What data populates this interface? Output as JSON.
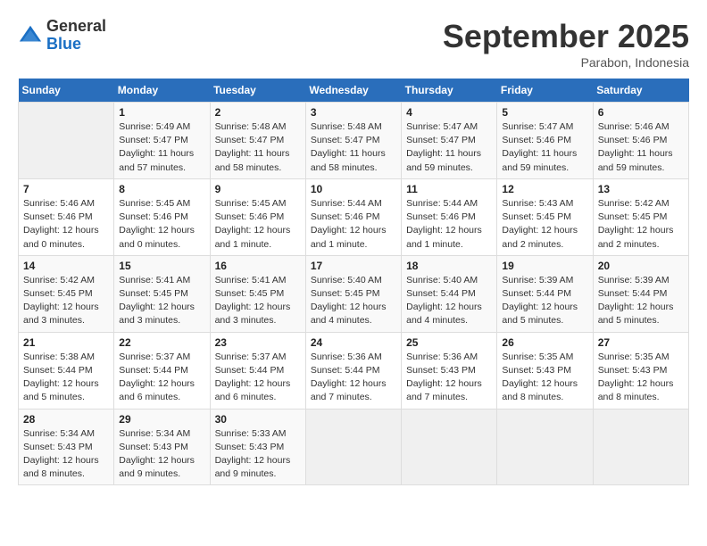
{
  "logo": {
    "general": "General",
    "blue": "Blue"
  },
  "title": "September 2025",
  "subtitle": "Parabon, Indonesia",
  "days_of_week": [
    "Sunday",
    "Monday",
    "Tuesday",
    "Wednesday",
    "Thursday",
    "Friday",
    "Saturday"
  ],
  "weeks": [
    [
      {
        "day": "",
        "empty": true
      },
      {
        "day": "1",
        "sunrise": "5:49 AM",
        "sunset": "5:47 PM",
        "daylight": "11 hours and 57 minutes."
      },
      {
        "day": "2",
        "sunrise": "5:48 AM",
        "sunset": "5:47 PM",
        "daylight": "11 hours and 58 minutes."
      },
      {
        "day": "3",
        "sunrise": "5:48 AM",
        "sunset": "5:47 PM",
        "daylight": "11 hours and 58 minutes."
      },
      {
        "day": "4",
        "sunrise": "5:47 AM",
        "sunset": "5:47 PM",
        "daylight": "11 hours and 59 minutes."
      },
      {
        "day": "5",
        "sunrise": "5:47 AM",
        "sunset": "5:46 PM",
        "daylight": "11 hours and 59 minutes."
      },
      {
        "day": "6",
        "sunrise": "5:46 AM",
        "sunset": "5:46 PM",
        "daylight": "11 hours and 59 minutes."
      }
    ],
    [
      {
        "day": "7",
        "sunrise": "5:46 AM",
        "sunset": "5:46 PM",
        "daylight": "12 hours and 0 minutes."
      },
      {
        "day": "8",
        "sunrise": "5:45 AM",
        "sunset": "5:46 PM",
        "daylight": "12 hours and 0 minutes."
      },
      {
        "day": "9",
        "sunrise": "5:45 AM",
        "sunset": "5:46 PM",
        "daylight": "12 hours and 1 minute."
      },
      {
        "day": "10",
        "sunrise": "5:44 AM",
        "sunset": "5:46 PM",
        "daylight": "12 hours and 1 minute."
      },
      {
        "day": "11",
        "sunrise": "5:44 AM",
        "sunset": "5:46 PM",
        "daylight": "12 hours and 1 minute."
      },
      {
        "day": "12",
        "sunrise": "5:43 AM",
        "sunset": "5:45 PM",
        "daylight": "12 hours and 2 minutes."
      },
      {
        "day": "13",
        "sunrise": "5:42 AM",
        "sunset": "5:45 PM",
        "daylight": "12 hours and 2 minutes."
      }
    ],
    [
      {
        "day": "14",
        "sunrise": "5:42 AM",
        "sunset": "5:45 PM",
        "daylight": "12 hours and 3 minutes."
      },
      {
        "day": "15",
        "sunrise": "5:41 AM",
        "sunset": "5:45 PM",
        "daylight": "12 hours and 3 minutes."
      },
      {
        "day": "16",
        "sunrise": "5:41 AM",
        "sunset": "5:45 PM",
        "daylight": "12 hours and 3 minutes."
      },
      {
        "day": "17",
        "sunrise": "5:40 AM",
        "sunset": "5:45 PM",
        "daylight": "12 hours and 4 minutes."
      },
      {
        "day": "18",
        "sunrise": "5:40 AM",
        "sunset": "5:44 PM",
        "daylight": "12 hours and 4 minutes."
      },
      {
        "day": "19",
        "sunrise": "5:39 AM",
        "sunset": "5:44 PM",
        "daylight": "12 hours and 5 minutes."
      },
      {
        "day": "20",
        "sunrise": "5:39 AM",
        "sunset": "5:44 PM",
        "daylight": "12 hours and 5 minutes."
      }
    ],
    [
      {
        "day": "21",
        "sunrise": "5:38 AM",
        "sunset": "5:44 PM",
        "daylight": "12 hours and 5 minutes."
      },
      {
        "day": "22",
        "sunrise": "5:37 AM",
        "sunset": "5:44 PM",
        "daylight": "12 hours and 6 minutes."
      },
      {
        "day": "23",
        "sunrise": "5:37 AM",
        "sunset": "5:44 PM",
        "daylight": "12 hours and 6 minutes."
      },
      {
        "day": "24",
        "sunrise": "5:36 AM",
        "sunset": "5:44 PM",
        "daylight": "12 hours and 7 minutes."
      },
      {
        "day": "25",
        "sunrise": "5:36 AM",
        "sunset": "5:43 PM",
        "daylight": "12 hours and 7 minutes."
      },
      {
        "day": "26",
        "sunrise": "5:35 AM",
        "sunset": "5:43 PM",
        "daylight": "12 hours and 8 minutes."
      },
      {
        "day": "27",
        "sunrise": "5:35 AM",
        "sunset": "5:43 PM",
        "daylight": "12 hours and 8 minutes."
      }
    ],
    [
      {
        "day": "28",
        "sunrise": "5:34 AM",
        "sunset": "5:43 PM",
        "daylight": "12 hours and 8 minutes."
      },
      {
        "day": "29",
        "sunrise": "5:34 AM",
        "sunset": "5:43 PM",
        "daylight": "12 hours and 9 minutes."
      },
      {
        "day": "30",
        "sunrise": "5:33 AM",
        "sunset": "5:43 PM",
        "daylight": "12 hours and 9 minutes."
      },
      {
        "day": "",
        "empty": true
      },
      {
        "day": "",
        "empty": true
      },
      {
        "day": "",
        "empty": true
      },
      {
        "day": "",
        "empty": true
      }
    ]
  ]
}
